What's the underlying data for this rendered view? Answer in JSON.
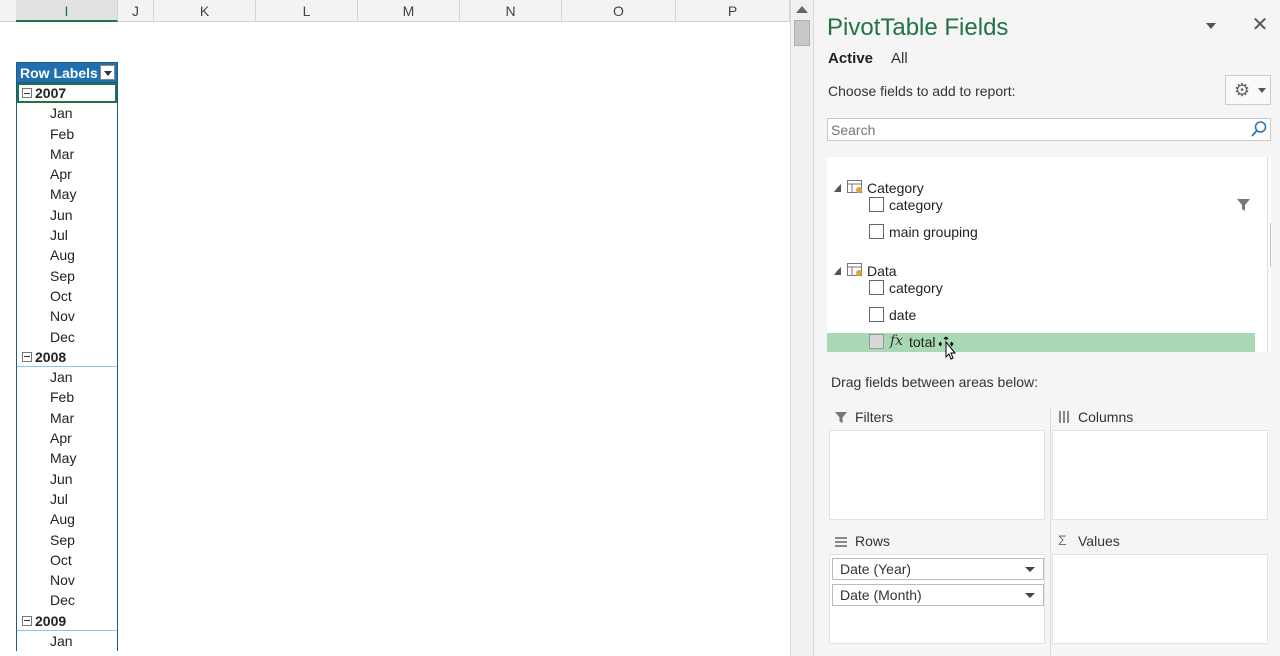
{
  "sheet": {
    "columns": [
      "I",
      "J",
      "K",
      "L",
      "M",
      "N",
      "O",
      "P"
    ],
    "selected_column": "I",
    "pivot": {
      "header": "Row Labels",
      "rows": [
        {
          "label": "2007",
          "type": "year",
          "active": true
        },
        {
          "label": "Jan",
          "type": "month"
        },
        {
          "label": "Feb",
          "type": "month"
        },
        {
          "label": "Mar",
          "type": "month"
        },
        {
          "label": "Apr",
          "type": "month"
        },
        {
          "label": "May",
          "type": "month"
        },
        {
          "label": "Jun",
          "type": "month"
        },
        {
          "label": "Jul",
          "type": "month"
        },
        {
          "label": "Aug",
          "type": "month"
        },
        {
          "label": "Sep",
          "type": "month"
        },
        {
          "label": "Oct",
          "type": "month"
        },
        {
          "label": "Nov",
          "type": "month"
        },
        {
          "label": "Dec",
          "type": "month"
        },
        {
          "label": "2008",
          "type": "year"
        },
        {
          "label": "Jan",
          "type": "month"
        },
        {
          "label": "Feb",
          "type": "month"
        },
        {
          "label": "Mar",
          "type": "month"
        },
        {
          "label": "Apr",
          "type": "month"
        },
        {
          "label": "May",
          "type": "month"
        },
        {
          "label": "Jun",
          "type": "month"
        },
        {
          "label": "Jul",
          "type": "month"
        },
        {
          "label": "Aug",
          "type": "month"
        },
        {
          "label": "Sep",
          "type": "month"
        },
        {
          "label": "Oct",
          "type": "month"
        },
        {
          "label": "Nov",
          "type": "month"
        },
        {
          "label": "Dec",
          "type": "month"
        },
        {
          "label": "2009",
          "type": "year"
        },
        {
          "label": "Jan",
          "type": "month"
        }
      ]
    }
  },
  "pane": {
    "title": "PivotTable Fields",
    "close_glyph": "✕",
    "tabs": {
      "active": "Active",
      "all": "All"
    },
    "choose_label": "Choose fields to add to report:",
    "search_placeholder": "Search",
    "tables": [
      {
        "name": "Category",
        "fields": [
          {
            "label": "category",
            "filtered": true
          },
          {
            "label": "main grouping"
          }
        ]
      },
      {
        "name": "Data",
        "fields": [
          {
            "label": "category"
          },
          {
            "label": "date"
          },
          {
            "label": "total",
            "calculated": true,
            "highlighted": true
          }
        ]
      }
    ],
    "fx_glyph": "fx",
    "drag_label": "Drag fields between areas below:",
    "areas": {
      "filters": "Filters",
      "columns": "Columns",
      "rows": "Rows",
      "values": "Values"
    },
    "values_glyph": "Σ",
    "row_fields": [
      "Date (Year)",
      "Date (Month)"
    ]
  },
  "colors": {
    "accent": "#217346",
    "pivot_header": "#1f6fb1",
    "highlight": "#a8d9b4"
  }
}
